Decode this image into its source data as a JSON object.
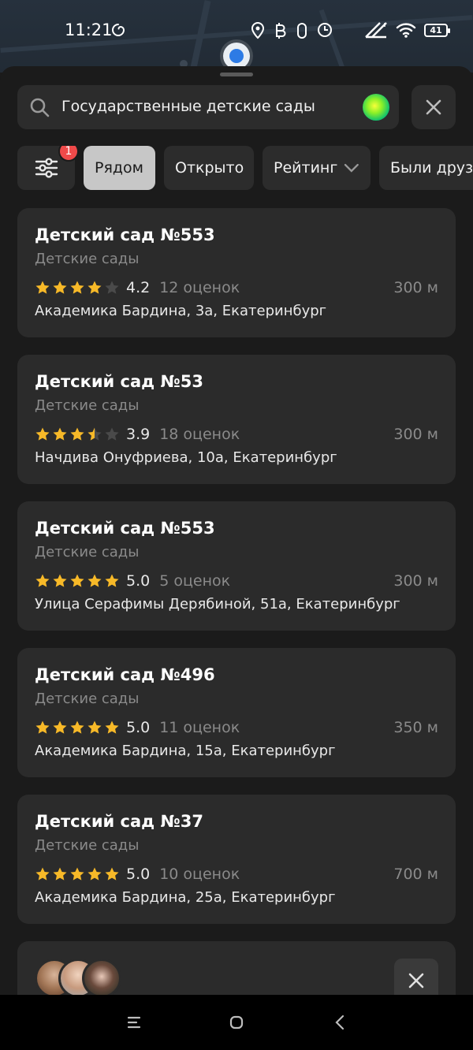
{
  "status_bar": {
    "time": "11:21",
    "battery": "41"
  },
  "search": {
    "query": "Государственные детские сады"
  },
  "filters": {
    "badge_count": "1",
    "chips": [
      "Рядом",
      "Открыто",
      "Рейтинг",
      "Были друзья"
    ]
  },
  "results": [
    {
      "title": "Детский сад №553",
      "category": "Детские сады",
      "rating": "4.2",
      "stars": 4.2,
      "reviews": "12 оценок",
      "distance": "300 м",
      "address": "Академика Бардина, 3а, Екатеринбург"
    },
    {
      "title": "Детский сад №53",
      "category": "Детские сады",
      "rating": "3.9",
      "stars": 3.5,
      "reviews": "18 оценок",
      "distance": "300 м",
      "address": "Начдива Онуфриева, 10а, Екатеринбург"
    },
    {
      "title": "Детский сад №553",
      "category": "Детские сады",
      "rating": "5.0",
      "stars": 5,
      "reviews": "5 оценок",
      "distance": "300 м",
      "address": "Улица Серафимы Дерябиной, 51а, Екатеринбург"
    },
    {
      "title": "Детский сад №496",
      "category": "Детские сады",
      "rating": "5.0",
      "stars": 5,
      "reviews": "11 оценок",
      "distance": "350 м",
      "address": "Академика Бардина, 15а, Екатеринбург"
    },
    {
      "title": "Детский сад №37",
      "category": "Детские сады",
      "rating": "5.0",
      "stars": 5,
      "reviews": "10 оценок",
      "distance": "700 м",
      "address": "Академика Бардина, 25а, Екатеринбург"
    }
  ],
  "colors": {
    "star_filled": "#f7b928",
    "star_empty": "#4a4a4a",
    "badge": "#f04a4a"
  }
}
